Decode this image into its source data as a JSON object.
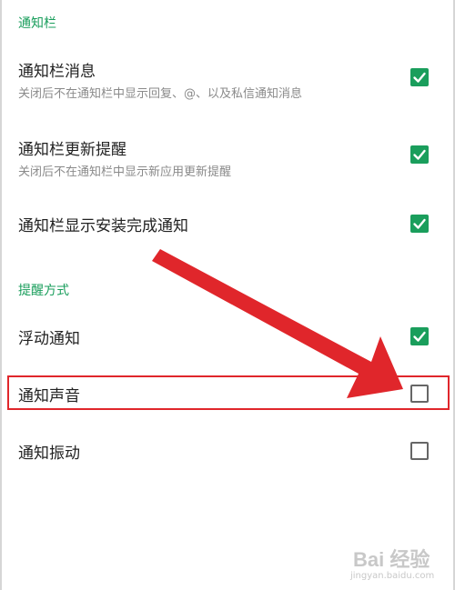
{
  "sections": {
    "notification_bar": {
      "header": "通知栏"
    },
    "alert_method": {
      "header": "提醒方式"
    }
  },
  "rows": {
    "bar_messages": {
      "title": "通知栏消息",
      "subtitle": "关闭后不在通知栏中显示回复、@、以及私信通知消息",
      "checked": true
    },
    "bar_update_reminder": {
      "title": "通知栏更新提醒",
      "subtitle": "关闭后不在通知栏中显示新应用更新提醒",
      "checked": true
    },
    "bar_install_complete": {
      "title": "通知栏显示安装完成通知",
      "checked": true
    },
    "floating_notification": {
      "title": "浮动通知",
      "checked": true
    },
    "notification_sound": {
      "title": "通知声音",
      "checked": false
    },
    "notification_vibration": {
      "title": "通知振动",
      "checked": false
    }
  },
  "colors": {
    "accent": "#1a9e5c",
    "highlight": "#e0262b",
    "unchecked_border": "#666666"
  },
  "watermark": {
    "brand": "Bai 经验",
    "url": "jingyan.baidu.com"
  }
}
